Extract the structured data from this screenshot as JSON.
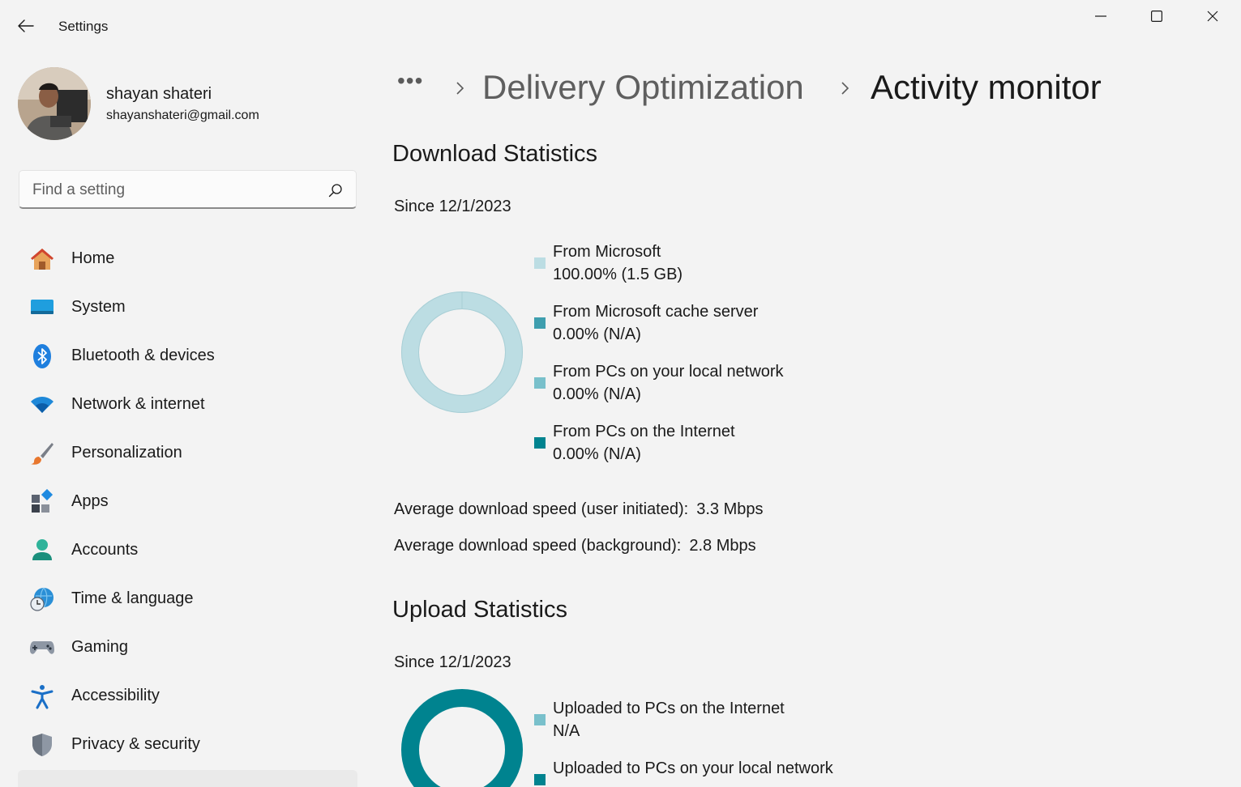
{
  "window": {
    "title": "Settings",
    "colors": {
      "background": "#f3f3f3",
      "accent": "#0a7fa3"
    }
  },
  "profile": {
    "name": "shayan shateri",
    "email": "shayanshateri@gmail.com"
  },
  "search": {
    "placeholder": "Find a setting"
  },
  "sidebar": {
    "items": [
      {
        "label": "Home",
        "icon": "home-icon"
      },
      {
        "label": "System",
        "icon": "system-icon"
      },
      {
        "label": "Bluetooth & devices",
        "icon": "bluetooth-icon"
      },
      {
        "label": "Network & internet",
        "icon": "wifi-icon"
      },
      {
        "label": "Personalization",
        "icon": "brush-icon"
      },
      {
        "label": "Apps",
        "icon": "apps-icon"
      },
      {
        "label": "Accounts",
        "icon": "person-icon"
      },
      {
        "label": "Time & language",
        "icon": "globe-clock-icon"
      },
      {
        "label": "Gaming",
        "icon": "gamepad-icon"
      },
      {
        "label": "Accessibility",
        "icon": "accessibility-icon"
      },
      {
        "label": "Privacy & security",
        "icon": "shield-icon"
      }
    ]
  },
  "breadcrumb": {
    "more": "•••",
    "items": [
      "Delivery Optimization",
      "Activity monitor"
    ]
  },
  "download": {
    "title": "Download Statistics",
    "since": "Since 12/1/2023",
    "legend": [
      {
        "name": "From Microsoft",
        "value": "100.00%  (1.5 GB)",
        "color": "#bcdde3"
      },
      {
        "name": "From Microsoft cache server",
        "value": "0.00%  (N/A)",
        "color": "#3e9eae"
      },
      {
        "name": "From PCs on your local network",
        "value": "0.00%  (N/A)",
        "color": "#79c0cb"
      },
      {
        "name": "From PCs on the Internet",
        "value": "0.00%  (N/A)",
        "color": "#00838f"
      }
    ],
    "avg_user_label": "Average download speed (user initiated):",
    "avg_user_value": "3.3 Mbps",
    "avg_bg_label": "Average download speed (background):",
    "avg_bg_value": "2.8 Mbps"
  },
  "upload": {
    "title": "Upload Statistics",
    "since": "Since 12/1/2023",
    "legend": [
      {
        "name": "Uploaded to PCs on the Internet",
        "value": "N/A",
        "color": "#79c0cb"
      },
      {
        "name": "Uploaded to PCs on your local network",
        "value": "",
        "color": "#00838f"
      }
    ]
  },
  "chart_data": [
    {
      "type": "pie",
      "categories": [
        "From Microsoft",
        "From Microsoft cache server",
        "From PCs on your local network",
        "From PCs on the Internet"
      ],
      "values": [
        100,
        0,
        0,
        0
      ],
      "colors": [
        "#bcdde3",
        "#3e9eae",
        "#79c0cb",
        "#00838f"
      ]
    },
    {
      "type": "pie",
      "categories": [
        "Uploaded to PCs on the Internet",
        "Uploaded to PCs on your local network"
      ],
      "colors": [
        "#79c0cb",
        "#00838f"
      ],
      "ring_color": "#00838f"
    }
  ]
}
